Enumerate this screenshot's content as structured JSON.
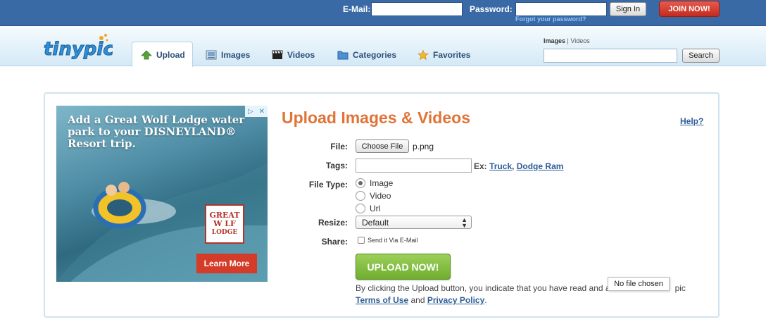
{
  "topbar": {
    "email_label": "E-Mail:",
    "password_label": "Password:",
    "signin_label": "Sign In",
    "forgot_label": "Forgot your password?",
    "join_label": "JOIN NOW!"
  },
  "header": {
    "logo_text": "tinypic",
    "tabs": [
      {
        "label": "Upload",
        "icon": "up-arrow-icon",
        "active": true
      },
      {
        "label": "Images",
        "icon": "images-icon"
      },
      {
        "label": "Videos",
        "icon": "clapperboard-icon"
      },
      {
        "label": "Categories",
        "icon": "folder-icon"
      },
      {
        "label": "Favorites",
        "icon": "star-icon"
      }
    ],
    "search": {
      "switch_images": "Images",
      "switch_sep": "|",
      "switch_videos": "Videos",
      "button_label": "Search"
    }
  },
  "ad": {
    "headline": "Add a Great Wolf Lodge water park to your DISNEYLAND® Resort trip.",
    "logo_line1": "GREAT",
    "logo_line2": "W  LF",
    "logo_line3": "LODGE",
    "cta_label": "Learn More"
  },
  "form": {
    "title": "Upload Images & Videos",
    "help_label": "Help?",
    "file_label": "File:",
    "choose_label": "Choose File",
    "file_name": "p.png",
    "tags_label": "Tags:",
    "tags_value": "",
    "ex_prefix": "Ex:",
    "ex_link1": "Truck",
    "ex_sep": ",",
    "ex_link2": "Dodge Ram",
    "filetype_label": "File Type:",
    "filetype_options": [
      "Image",
      "Video",
      "Url"
    ],
    "resize_label": "Resize:",
    "resize_value": "Default",
    "share_label": "Share:",
    "share_option": "Send it Via E-Mail",
    "upload_label": "UPLOAD NOW!",
    "legal_text": "By clicking the Upload button, you indicate that you have read and a",
    "legal_tail": "pic",
    "terms_label": "Terms of Use",
    "and_text": "and",
    "privacy_label": "Privacy Policy",
    "period": ".",
    "tooltip": "No file chosen"
  }
}
